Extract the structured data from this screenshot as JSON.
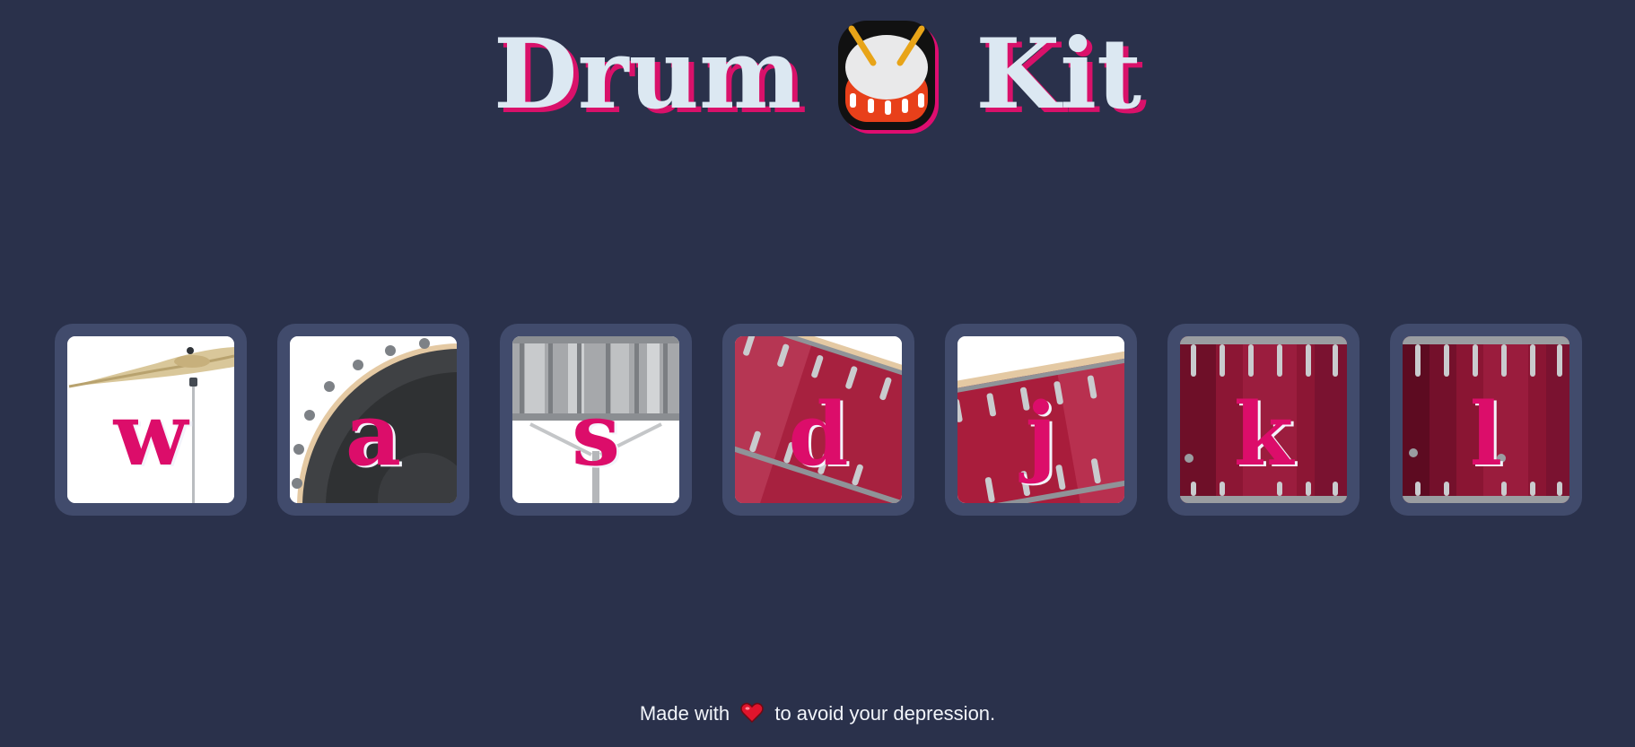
{
  "header": {
    "title_left": "Drum",
    "title_icon": "drum-icon",
    "title_right": "Kit",
    "accent_color": "#d9116a",
    "title_color": "#dce8f2"
  },
  "drums": [
    {
      "key": "w",
      "image": "crash-cymbal-icon"
    },
    {
      "key": "a",
      "image": "kick-drum-icon"
    },
    {
      "key": "s",
      "image": "snare-drum-icon"
    },
    {
      "key": "d",
      "image": "tom-drum-icon"
    },
    {
      "key": "j",
      "image": "tom-drum-icon"
    },
    {
      "key": "k",
      "image": "floor-tom-icon"
    },
    {
      "key": "l",
      "image": "floor-tom-icon"
    }
  ],
  "footer": {
    "before": "Made with",
    "icon": "heart-icon",
    "after": "to avoid your depression."
  },
  "colors": {
    "background": "#2a314b",
    "pad_frame": "#414b6c",
    "key_letter": "#dc0d6a"
  }
}
